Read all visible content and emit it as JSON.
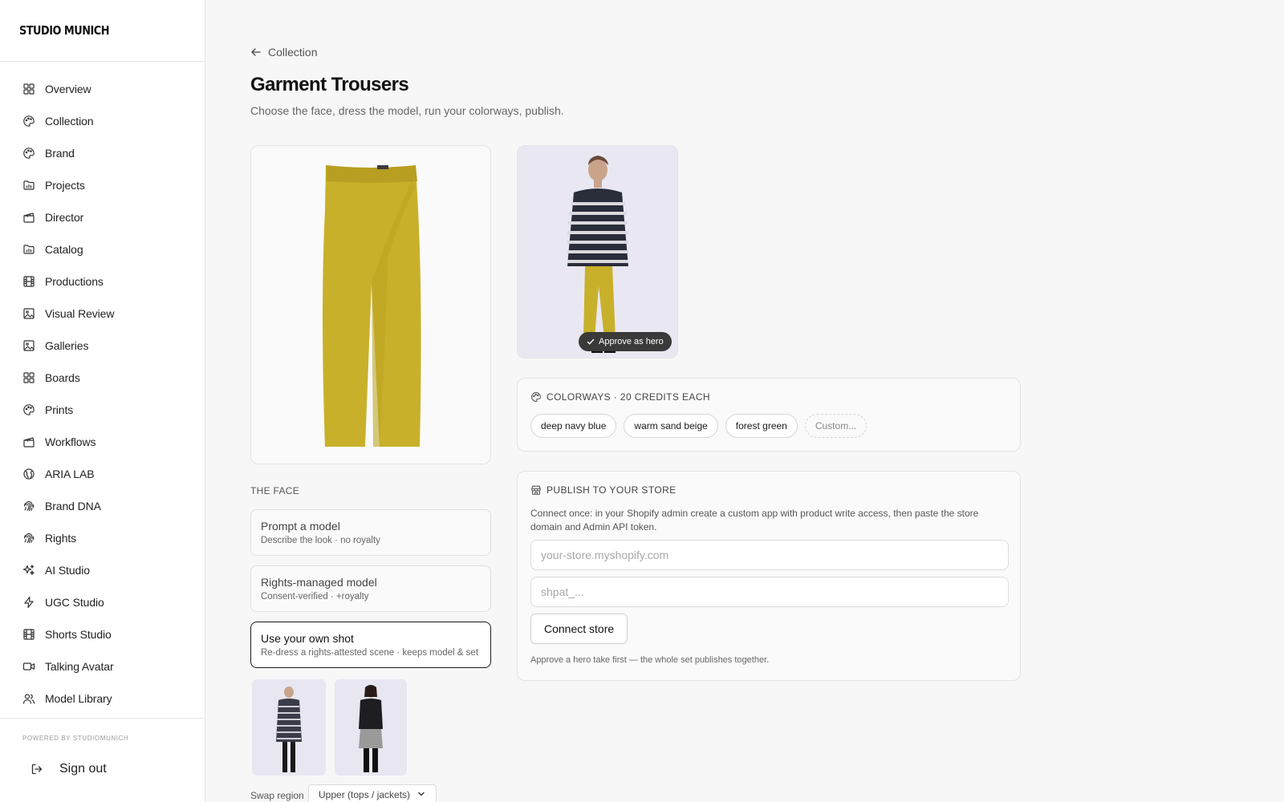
{
  "app": {
    "logo": "STUDIO MUNICH",
    "powered_by": "POWERED BY STUDIOMUNICH",
    "sign_out": "Sign out"
  },
  "sidebar": {
    "items": [
      {
        "label": "Overview",
        "icon": "grid-icon"
      },
      {
        "label": "Collection",
        "icon": "palette-icon"
      },
      {
        "label": "Brand",
        "icon": "palette-icon"
      },
      {
        "label": "Projects",
        "icon": "folder-chart-icon"
      },
      {
        "label": "Director",
        "icon": "clapperboard-icon"
      },
      {
        "label": "Catalog",
        "icon": "folder-chart-icon"
      },
      {
        "label": "Productions",
        "icon": "film-icon"
      },
      {
        "label": "Visual Review",
        "icon": "image-icon"
      },
      {
        "label": "Galleries",
        "icon": "image-icon"
      },
      {
        "label": "Boards",
        "icon": "grid-icon"
      },
      {
        "label": "Prints",
        "icon": "palette-icon"
      },
      {
        "label": "Workflows",
        "icon": "clapperboard-icon"
      },
      {
        "label": "ARIA LAB",
        "icon": "globe-icon"
      },
      {
        "label": "Brand DNA",
        "icon": "fingerprint-icon"
      },
      {
        "label": "Rights",
        "icon": "fingerprint-icon"
      },
      {
        "label": "AI Studio",
        "icon": "sparkles-icon"
      },
      {
        "label": "UGC Studio",
        "icon": "bolt-icon"
      },
      {
        "label": "Shorts Studio",
        "icon": "film-icon"
      },
      {
        "label": "Talking Avatar",
        "icon": "video-icon"
      },
      {
        "label": "Model Library",
        "icon": "users-icon"
      }
    ]
  },
  "header": {
    "back_label": "Collection",
    "title": "Garment Trousers",
    "subtitle": "Choose the face, dress the model, run your colorways, publish."
  },
  "hero": {
    "approve_label": "Approve as hero"
  },
  "face": {
    "section_label": "THE FACE",
    "options": [
      {
        "title": "Prompt a model",
        "sub": "Describe the look · no royalty",
        "active": false
      },
      {
        "title": "Rights-managed model",
        "sub": "Consent-verified · +royalty",
        "active": false
      },
      {
        "title": "Use your own shot",
        "sub": "Re-dress a rights-attested scene · keeps model & set",
        "active": true
      }
    ],
    "swap_label": "Swap region",
    "swap_value": "Upper (tops / jackets)"
  },
  "colorways": {
    "heading": "COLORWAYS · 20 CREDITS EACH",
    "chips": [
      "deep navy blue",
      "warm sand beige",
      "forest green"
    ],
    "custom_label": "Custom..."
  },
  "publish": {
    "heading": "PUBLISH TO YOUR STORE",
    "description": "Connect once: in your Shopify admin create a custom app with product write access, then paste the store domain and Admin API token.",
    "domain_placeholder": "your-store.myshopify.com",
    "token_placeholder": "shpat_...",
    "connect_label": "Connect store",
    "note": "Approve a hero take first — the whole set publishes together."
  },
  "colors": {
    "garment": "#c9b02a",
    "accent": "#1a1a1a",
    "hero_bg": "#e9e8f2"
  }
}
